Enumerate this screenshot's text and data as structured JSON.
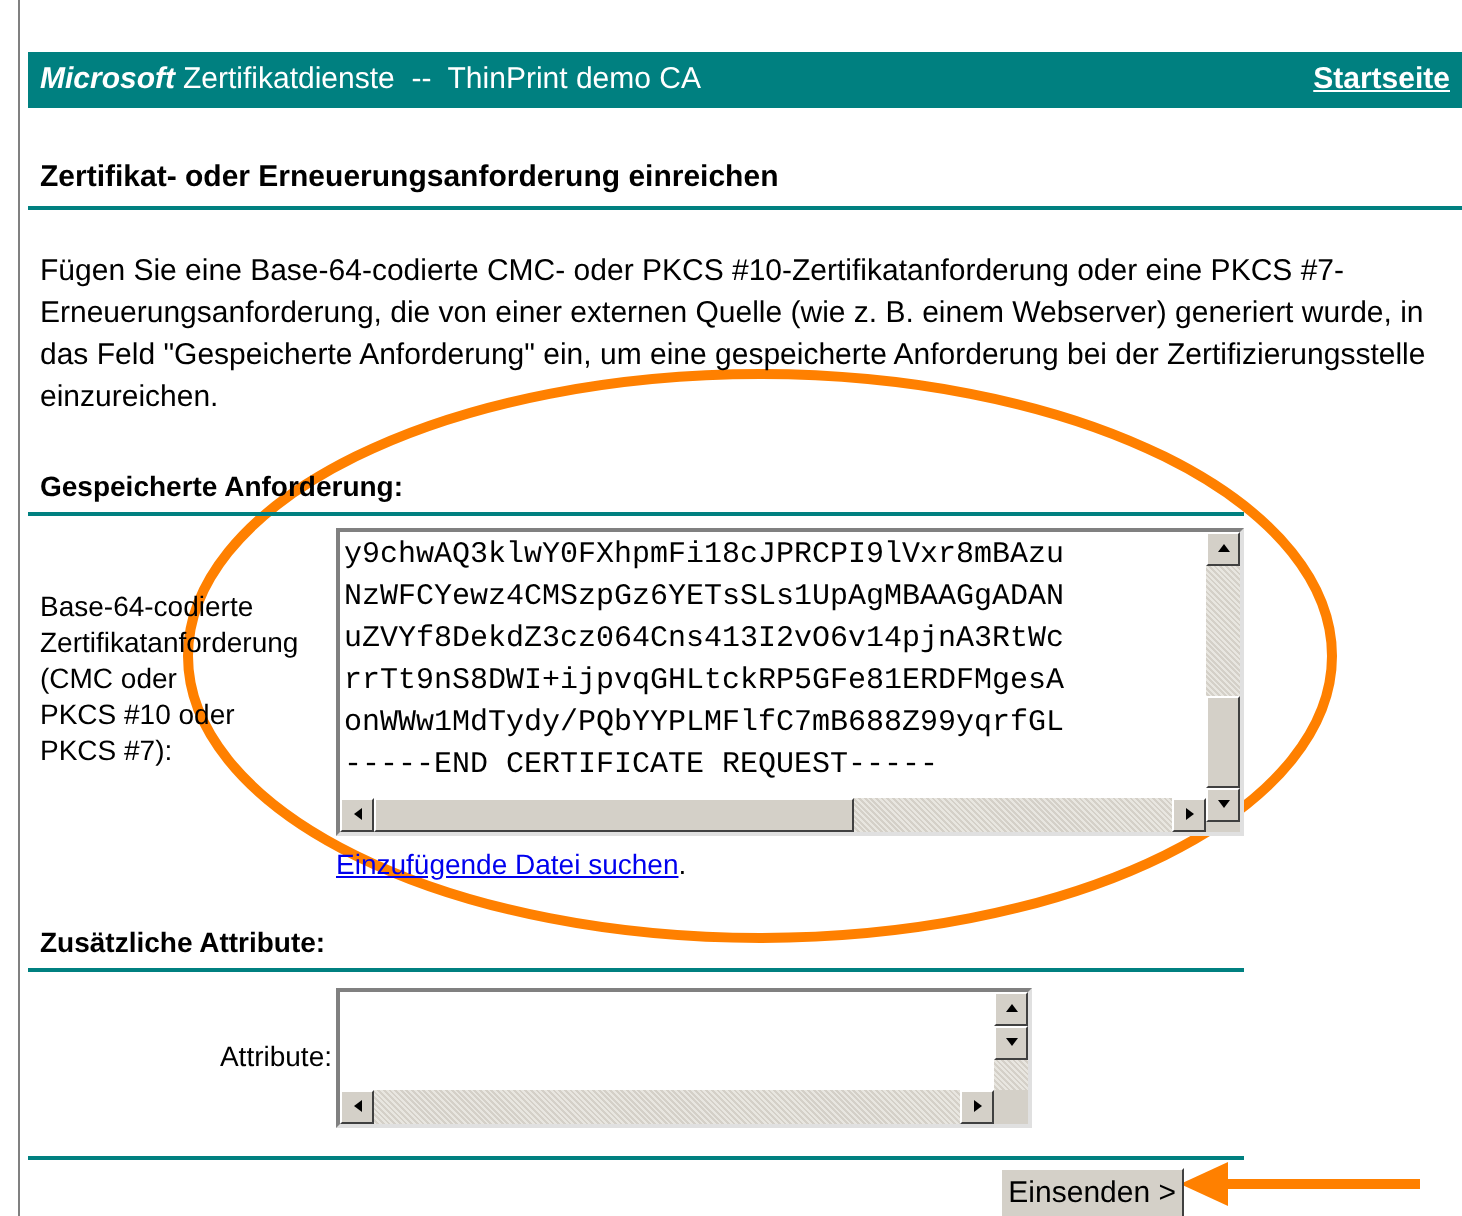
{
  "header": {
    "brand": "Microsoft",
    "title": "Zertifikatdienste  --  ThinPrint demo CA",
    "home_link": "Startseite"
  },
  "heading": "Zertifikat- oder Erneuerungsanforderung einreichen",
  "intro": "Fügen Sie eine Base-64-codierte CMC- oder PKCS #10-Zertifikatanforderung oder eine PKCS #7-Erneuerungsanforderung, die von einer externen Quelle (wie z. B. einem Webserver) generiert wurde, in das Feld \"Gespeicherte Anforderung\" ein, um eine gespeicherte Anforderung bei der Zertifizierungsstelle einzureichen.",
  "saved_request": {
    "section_title": "Gespeicherte Anforderung:",
    "label_lines": [
      "Base-64-codierte",
      "Zertifikatanforderung",
      "(CMC oder",
      "PKCS #10 oder",
      "PKCS #7):"
    ],
    "value_lines": [
      "y9chwAQ3klwY0FXhpmFi18cJPRCPI9lVxr8mBAzu",
      "NzWFCYewz4CMSzpGz6YETsSLs1UpAgMBAAGgADAN",
      "uZVYf8DekdZ3cz064Cns413I2vO6v14pjnA3RtWc",
      "rrTt9nS8DWI+ijpvqGHLtckRP5GFe81ERDFMgesA",
      "onWWw1MdTydy/PQbYYPLMFlfC7mB688Z99yqrfGL",
      "-----END CERTIFICATE REQUEST-----"
    ],
    "browse_link": "Einzufügende Datei suchen",
    "browse_link_suffix": "."
  },
  "attributes": {
    "section_title": "Zusätzliche Attribute:",
    "label": "Attribute:"
  },
  "submit_button": "Einsenden >"
}
